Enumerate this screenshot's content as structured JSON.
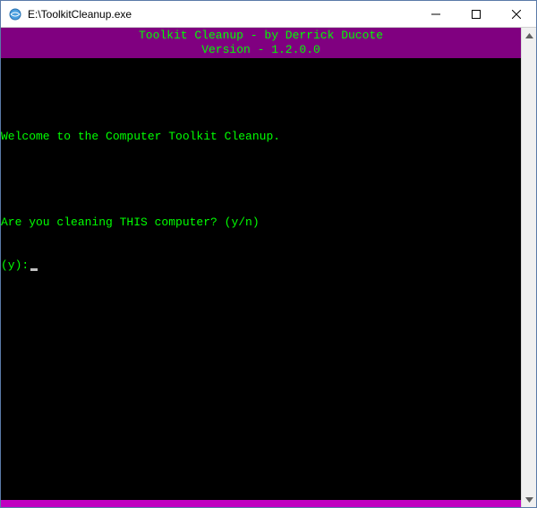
{
  "window": {
    "title": "E:\\ToolkitCleanup.exe"
  },
  "banner": {
    "line1": "Toolkit Cleanup - by Derrick Ducote",
    "line2": "Version - 1.2.0.0"
  },
  "terminal": {
    "welcome": "Welcome to the Computer Toolkit Cleanup.",
    "question": "Are you cleaning THIS computer? (y/n)",
    "prompt": "(y):"
  },
  "colors": {
    "banner_bg": "#800080",
    "text_green": "#00ff00",
    "bottom_bar": "#c000c0"
  }
}
